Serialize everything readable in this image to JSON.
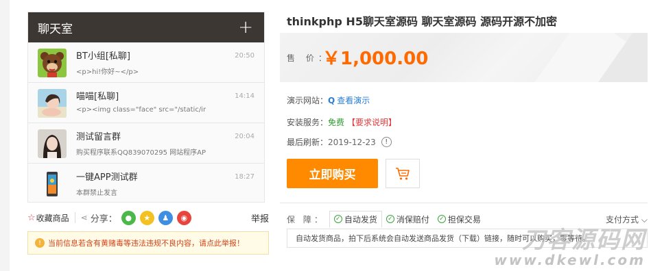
{
  "chat_preview": {
    "title": "聊天室",
    "add_icon": "plus-icon",
    "items": [
      {
        "name": "BT小组[私聊]",
        "message": "<p>hi!你好~</p>",
        "time": "20:50"
      },
      {
        "name": "喵喵[私聊]",
        "message": "<p><img class=\"face\" src=\"/static/ir",
        "time": "14:14"
      },
      {
        "name": "测试留言群",
        "message": "购买程序联系QQ839070295 网站程序AP",
        "time": "20:04"
      },
      {
        "name": "一键APP测试群",
        "message": "本群禁止发言",
        "time": "18:27"
      }
    ]
  },
  "share_bar": {
    "favorite": "收藏商品",
    "share": "分享：",
    "report": "举报"
  },
  "warning": {
    "text": "当前信息若含有黄赌毒等违法违规不良内容，请点此举报！"
  },
  "product": {
    "title": "thinkphp H5聊天室源码 聊天室源码 源码开源不加密",
    "price_label": "售 价：",
    "price": "￥1,000.00",
    "demo_label": "演示网站：",
    "demo_link": "查看演示",
    "install_label": "安装服务：",
    "install_value": "免费",
    "install_note": "【要求说明】",
    "refresh_label": "最后刷新：",
    "refresh_date": "2019-12-23",
    "buy_button": "立即购买"
  },
  "guarantee": {
    "label": "保 障：",
    "items": [
      "自动发货",
      "消保赔付",
      "担保交易"
    ],
    "payment": "支付方式",
    "description": "自动发货商品，拍下后系统会自动发送商品发货（下载）链接，随时可以购买，零等待。"
  },
  "watermark": {
    "main": "刀客源码网",
    "sub": "www.dkewl.com"
  },
  "colors": {
    "accent_orange": "#ff6a00",
    "buy_button": "#ff8a00",
    "chat_header": "#3c3733",
    "link_blue": "#2a7fd4",
    "free_green": "#2e9a2e",
    "alert_red": "#e4393c"
  }
}
